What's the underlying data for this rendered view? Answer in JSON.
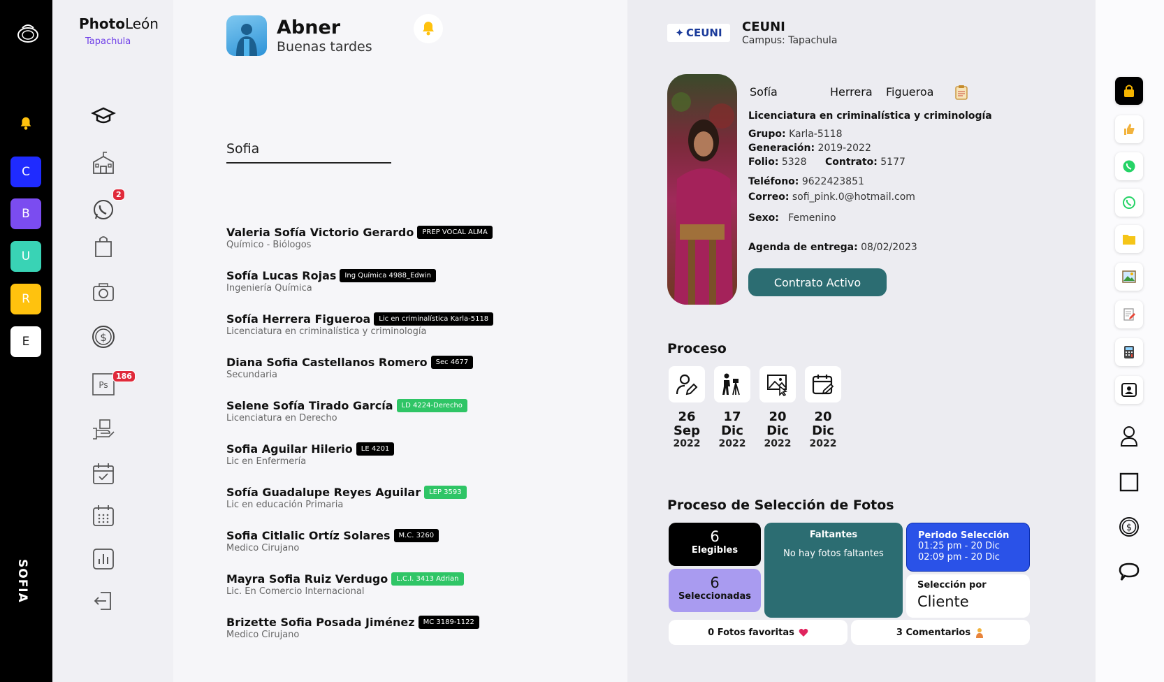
{
  "rail": {
    "letters": [
      {
        "label": "C",
        "color": "#1f2bff"
      },
      {
        "label": "B",
        "color": "#7b4cf0"
      },
      {
        "label": "U",
        "color": "#39d3b5"
      },
      {
        "label": "R",
        "color": "#ffc20e"
      },
      {
        "label": "E",
        "color": "#ffffff"
      }
    ],
    "user_vertical": "SOFIA"
  },
  "nav": {
    "brand_bold": "Photo",
    "brand_rest": "León",
    "city": "Tapachula",
    "items": [
      {
        "icon": "graduation-cap-icon"
      },
      {
        "icon": "school-building-icon"
      },
      {
        "icon": "whatsapp-icon",
        "badge": "2"
      },
      {
        "icon": "shopping-bag-icon"
      },
      {
        "icon": "camera-icon"
      },
      {
        "icon": "dollar-coin-icon"
      },
      {
        "icon": "photoshop-icon",
        "badge": "186"
      },
      {
        "icon": "delivery-hand-icon"
      },
      {
        "icon": "calendar-check-icon"
      },
      {
        "icon": "calendar-grid-icon"
      },
      {
        "icon": "bar-chart-icon"
      },
      {
        "icon": "logout-icon"
      }
    ]
  },
  "header": {
    "name": "Abner",
    "greeting": "Buenas tardes"
  },
  "search": {
    "value": "Sofia"
  },
  "results": [
    {
      "name": "Valeria Sofía Victorio Gerardo",
      "tag": "PREP VOCAL ALMA",
      "tag_color": "black",
      "sub": "Químico - Biólogos"
    },
    {
      "name": "Sofía Lucas Rojas",
      "tag": "Ing Química 4988_Edwin",
      "tag_color": "black",
      "sub": "Ingeniería Química"
    },
    {
      "name": "Sofía Herrera Figueroa",
      "tag": "Lic en criminalística Karla-5118",
      "tag_color": "black",
      "sub": "Licenciatura en criminalística y criminología"
    },
    {
      "name": "Diana Sofia Castellanos Romero",
      "tag": "Sec 4677",
      "tag_color": "black",
      "sub": "Secundaria"
    },
    {
      "name": "Selene Sofía Tirado García",
      "tag": "LD 4224-Derecho",
      "tag_color": "green",
      "sub": "Licenciatura en Derecho"
    },
    {
      "name": "Sofia Aguilar Hilerio",
      "tag": "LE 4201",
      "tag_color": "black",
      "sub": "Lic en Enfermería"
    },
    {
      "name": "Sofía Guadalupe Reyes Aguilar",
      "tag": "LEP 3593",
      "tag_color": "green",
      "sub": "Lic en educación Primaria"
    },
    {
      "name": "Sofia Citlalic Ortíz Solares",
      "tag": "M.C. 3260",
      "tag_color": "black",
      "sub": "Medico Cirujano"
    },
    {
      "name": "Mayra Sofia Ruiz Verdugo",
      "tag": "L.C.I. 3413 Adrian",
      "tag_color": "green",
      "sub": "Lic. En Comercio Internacional"
    },
    {
      "name": "Brizette Sofia Posada Jiménez",
      "tag": "MC 3189-1122",
      "tag_color": "black",
      "sub": "Medico Cirujano"
    }
  ],
  "detail": {
    "school_logo": "CEUNI",
    "school": "CEUNI",
    "campus": "Campus: Tapachula",
    "first_name": "Sofía",
    "last_name_1": "Herrera",
    "last_name_2": "Figueroa",
    "career": "Licenciatura en criminalística y criminología",
    "grupo_label": "Grupo:",
    "grupo": "Karla-5118",
    "generacion_label": "Generación:",
    "generacion": "2019-2022",
    "folio_label": "Folio:",
    "folio": "5328",
    "contrato_label": "Contrato:",
    "contrato": "5177",
    "telefono_label": "Teléfono:",
    "telefono": "9622423851",
    "correo_label": "Correo:",
    "correo": "sofi_pink.0@hotmail.com",
    "sexo_label": "Sexo:",
    "sexo": "Femenino",
    "agenda_label": "Agenda de entrega:",
    "agenda": "08/02/2023",
    "contract_button": "Contrato Activo"
  },
  "process": {
    "title": "Proceso",
    "steps": [
      {
        "icon": "user-edit-icon",
        "day": "26",
        "month": "Sep",
        "year": "2022"
      },
      {
        "icon": "photographer-icon",
        "day": "17",
        "month": "Dic",
        "year": "2022"
      },
      {
        "icon": "photo-select-icon",
        "day": "20",
        "month": "Dic",
        "year": "2022"
      },
      {
        "icon": "calendar-edit-icon",
        "day": "20",
        "month": "Dic",
        "year": "2022"
      }
    ]
  },
  "selection": {
    "title": "Proceso de Selección de Fotos",
    "eligible_count": "6",
    "eligible_label": "Elegibles",
    "selected_count": "6",
    "selected_label": "Seleccionadas",
    "missing_title": "Faltantes",
    "missing_text": "No hay fotos faltantes",
    "period_title": "Periodo Selección",
    "period_line1": "01:25 pm - 20 Dic",
    "period_line2": "02:09 pm - 20 Dic",
    "selected_by_title": "Selección por",
    "selected_by": "Cliente",
    "favorites": "0 Fotos favoritas",
    "comments": "3 Comentarios"
  },
  "actions": [
    {
      "icon": "lock-icon"
    },
    {
      "icon": "thumbs-up-icon"
    },
    {
      "icon": "whatsapp-green-icon"
    },
    {
      "icon": "whatsapp-outline-icon"
    },
    {
      "icon": "folder-icon"
    },
    {
      "icon": "image-icon"
    },
    {
      "icon": "document-edit-icon"
    },
    {
      "icon": "calculator-icon"
    },
    {
      "icon": "contact-card-icon"
    },
    {
      "icon": "user-outline-icon"
    },
    {
      "icon": "square-outline-icon"
    },
    {
      "icon": "dollar-circle-icon"
    },
    {
      "icon": "chat-bubble-icon"
    }
  ],
  "colors": {
    "teal": "#2c6d72",
    "blue": "#2a52e8",
    "lavender": "#a99bf0",
    "accent_purple": "#6f3fe8",
    "badge_red": "#e02a3a",
    "tag_green": "#2fc566"
  }
}
